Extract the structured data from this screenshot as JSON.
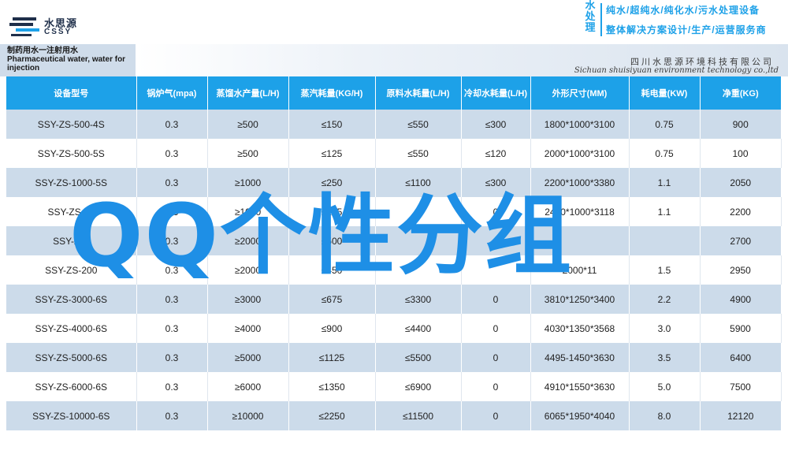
{
  "header": {
    "logo_cn": "水思源",
    "logo_en": "CSSY",
    "brand_vertical": [
      "水",
      "处",
      "理"
    ],
    "tagline_1": "纯水/超纯水/纯化水/污水处理设备",
    "tagline_2": "整体解决方案设计/生产/运营服务商"
  },
  "title": {
    "cn": "制药用水一注射用水",
    "en": "Pharmaceutical water, water for injection"
  },
  "company": {
    "cn": "四川水思源环境科技有限公司",
    "en": "Sichuan shuisiyuan environment technology co.,ltd"
  },
  "table": {
    "headers": [
      "设备型号",
      "锅炉气(mpa)",
      "蒸馏水产量(L/H)",
      "蒸汽耗量(KG/H)",
      "原料水耗量(L/H)",
      "冷却水耗量(L/H)",
      "外形尺寸(MM)",
      "耗电量(KW)",
      "净重(KG)"
    ],
    "rows": [
      [
        "SSY-ZS-500-4S",
        "0.3",
        "≥500",
        "≤150",
        "≤550",
        "≤300",
        "1800*1000*3100",
        "0.75",
        "900"
      ],
      [
        "SSY-ZS-500-5S",
        "0.3",
        "≥500",
        "≤125",
        "≤550",
        "≤120",
        "2000*1000*3100",
        "0.75",
        "100"
      ],
      [
        "SSY-ZS-1000-5S",
        "0.3",
        "≥1000",
        "≤250",
        "≤1100",
        "≤300",
        "2200*1000*3380",
        "1.1",
        "2050"
      ],
      [
        "SSY-ZS-10",
        "0.3",
        "≥1000",
        "≤225",
        "",
        "0",
        "2450*1000*3118",
        "1.1",
        "2200"
      ],
      [
        "SSY-ZS-",
        "0.3",
        "≥2000",
        "≤500",
        "",
        "",
        "",
        "",
        "2700"
      ],
      [
        "SSY-ZS-200",
        "0.3",
        "≥2000",
        "≤450",
        "",
        "",
        "2000*11",
        "1.5",
        "2950"
      ],
      [
        "SSY-ZS-3000-6S",
        "0.3",
        "≥3000",
        "≤675",
        "≤3300",
        "0",
        "3810*1250*3400",
        "2.2",
        "4900"
      ],
      [
        "SSY-ZS-4000-6S",
        "0.3",
        "≥4000",
        "≤900",
        "≤4400",
        "0",
        "4030*1350*3568",
        "3.0",
        "5900"
      ],
      [
        "SSY-ZS-5000-6S",
        "0.3",
        "≥5000",
        "≤1125",
        "≤5500",
        "0",
        "4495-1450*3630",
        "3.5",
        "6400"
      ],
      [
        "SSY-ZS-6000-6S",
        "0.3",
        "≥6000",
        "≤1350",
        "≤6900",
        "0",
        "4910*1550*3630",
        "5.0",
        "7500"
      ],
      [
        "SSY-ZS-10000-6S",
        "0.3",
        "≥10000",
        "≤2250",
        "≤11500",
        "0",
        "6065*1950*4040",
        "8.0",
        "12120"
      ]
    ]
  },
  "watermark": "QQ个性分组",
  "colors": {
    "accent": "#1da1e8",
    "row_tint": "#ccdbea",
    "watermark": "#1e8fe6"
  }
}
